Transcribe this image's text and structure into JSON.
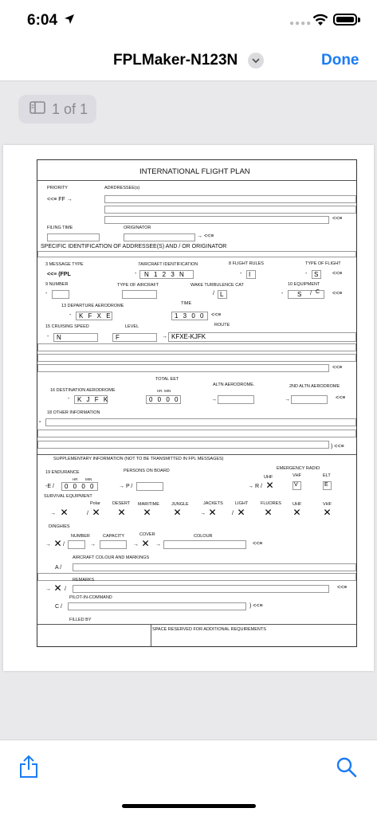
{
  "status": {
    "time": "6:04"
  },
  "nav": {
    "title": "FPLMaker-N123N",
    "done": "Done"
  },
  "page_indicator": "1 of 1",
  "form": {
    "title": "INTERNATIONAL FLIGHT PLAN",
    "priority_label": "PRIORITY",
    "addressee_label": "ADRDRESSEE(s)",
    "priority_value": "<<≡  FF →",
    "end_marker": "<<≡",
    "filing_time_label": "FILING TIME",
    "originator_label": "ORIGINATOR",
    "originator_marker": "→ <<≡",
    "specific_id_label": "SPECIFIC IDENTIFICATION  OF  ADDRESSEE(S) AND / OR  ORIGINATOR",
    "message_type_label": "3 MESSAGE TYPE",
    "aircraft_id_label": "7AIRCRAFT IDENTIFICATION",
    "flight_rules_label": "8 FLIGHT RULES",
    "type_of_flight_label": "TYPE OF FLIGHT",
    "message_type_value": "<<≡  (FPL",
    "aircraft_id_value": "N 1 2 3 N",
    "flight_rules_value": "I",
    "type_of_flight_value": "S",
    "number_label": "9 NUMBER",
    "type_of_aircraft_label": "TYPE OF AIRCRAFT",
    "wake_label": "WAKE TURBULENCE CAT",
    "equipment_label": "10 EQUIPMENT",
    "wake_value": "L",
    "equipment_value": "S",
    "equipment_value2": "C",
    "departure_label": "13 DEPARTURE AERODROME",
    "time_label": "TIME",
    "departure_value": "K F X E",
    "time_value": "1 3 0 0",
    "cruising_label": "15 CRUISING SPEED",
    "level_label": "LEVEL",
    "route_label": "ROUTE",
    "speed_value": "N",
    "level_value": "F",
    "route_value": "KFXE-KJFK",
    "total_eet_label": "TOTAL EET",
    "hr_min_label": "HR.  MIN",
    "destination_label": "16 DESTINATION AERODROME",
    "altn_label": "ALTN AERODROME.",
    "altn2_label": "2ND ALTN AERODROME",
    "destination_value": "K J F K",
    "eet_value": "0 0 0 0",
    "other_info_label": "18  OTHER INFORMATION",
    "other_info_end": ") <<≡",
    "supplementary_label": "SUPPLEMENTARY INFORMATION (NOT TO BE TRANSMITTED IN FPL MESSAGES)",
    "endurance_label": "19  ENDURANCE",
    "persons_label": "PERSONS ON BOARD",
    "emergency_radio_label": "EMERGENCY RADIO",
    "hr_label": "HR",
    "min_label": "MIN",
    "uhf_label": "UHF",
    "vhf_label": "VHF",
    "elt_label": "ELT",
    "endurance_prefix": "-E /",
    "endurance_value": "0 0 0 0",
    "persons_prefix": "→ P /",
    "radio_prefix": "→ R /",
    "vhf_value": "V",
    "elt_value": "E",
    "survival_label": "SURVIVAL EQUIPMENT",
    "polar_label": "Polar",
    "desert_label": "DESERT",
    "maritime_label": "MARITIME",
    "jungle_label": "JUNGLE",
    "jackets_label": "JACKETS",
    "light_label": "LIGHT",
    "fluores_label": "FLUORES",
    "uhf2_label": "UHF",
    "vhf2_label": "VHF",
    "dinghies_label": "DINGHIES",
    "number2_label": "NUMBER",
    "capacity_label": "CAPACITY",
    "cover_label": "COVER",
    "colour_label": "COLOUR",
    "aircraft_colour_label": "AIRCRAFT COLOUR AND MARKINGS",
    "a_prefix": "A /",
    "remarks_label": "REMARKS",
    "pic_label": "PILOT-IN-COMMAND",
    "c_prefix": "C /",
    "pic_end": ") <<≡",
    "filled_by_label": "FILLED BY",
    "space_reserved_label": "SPACE RESERVED FOR ADDITIONAL REQUIREMENTS"
  }
}
